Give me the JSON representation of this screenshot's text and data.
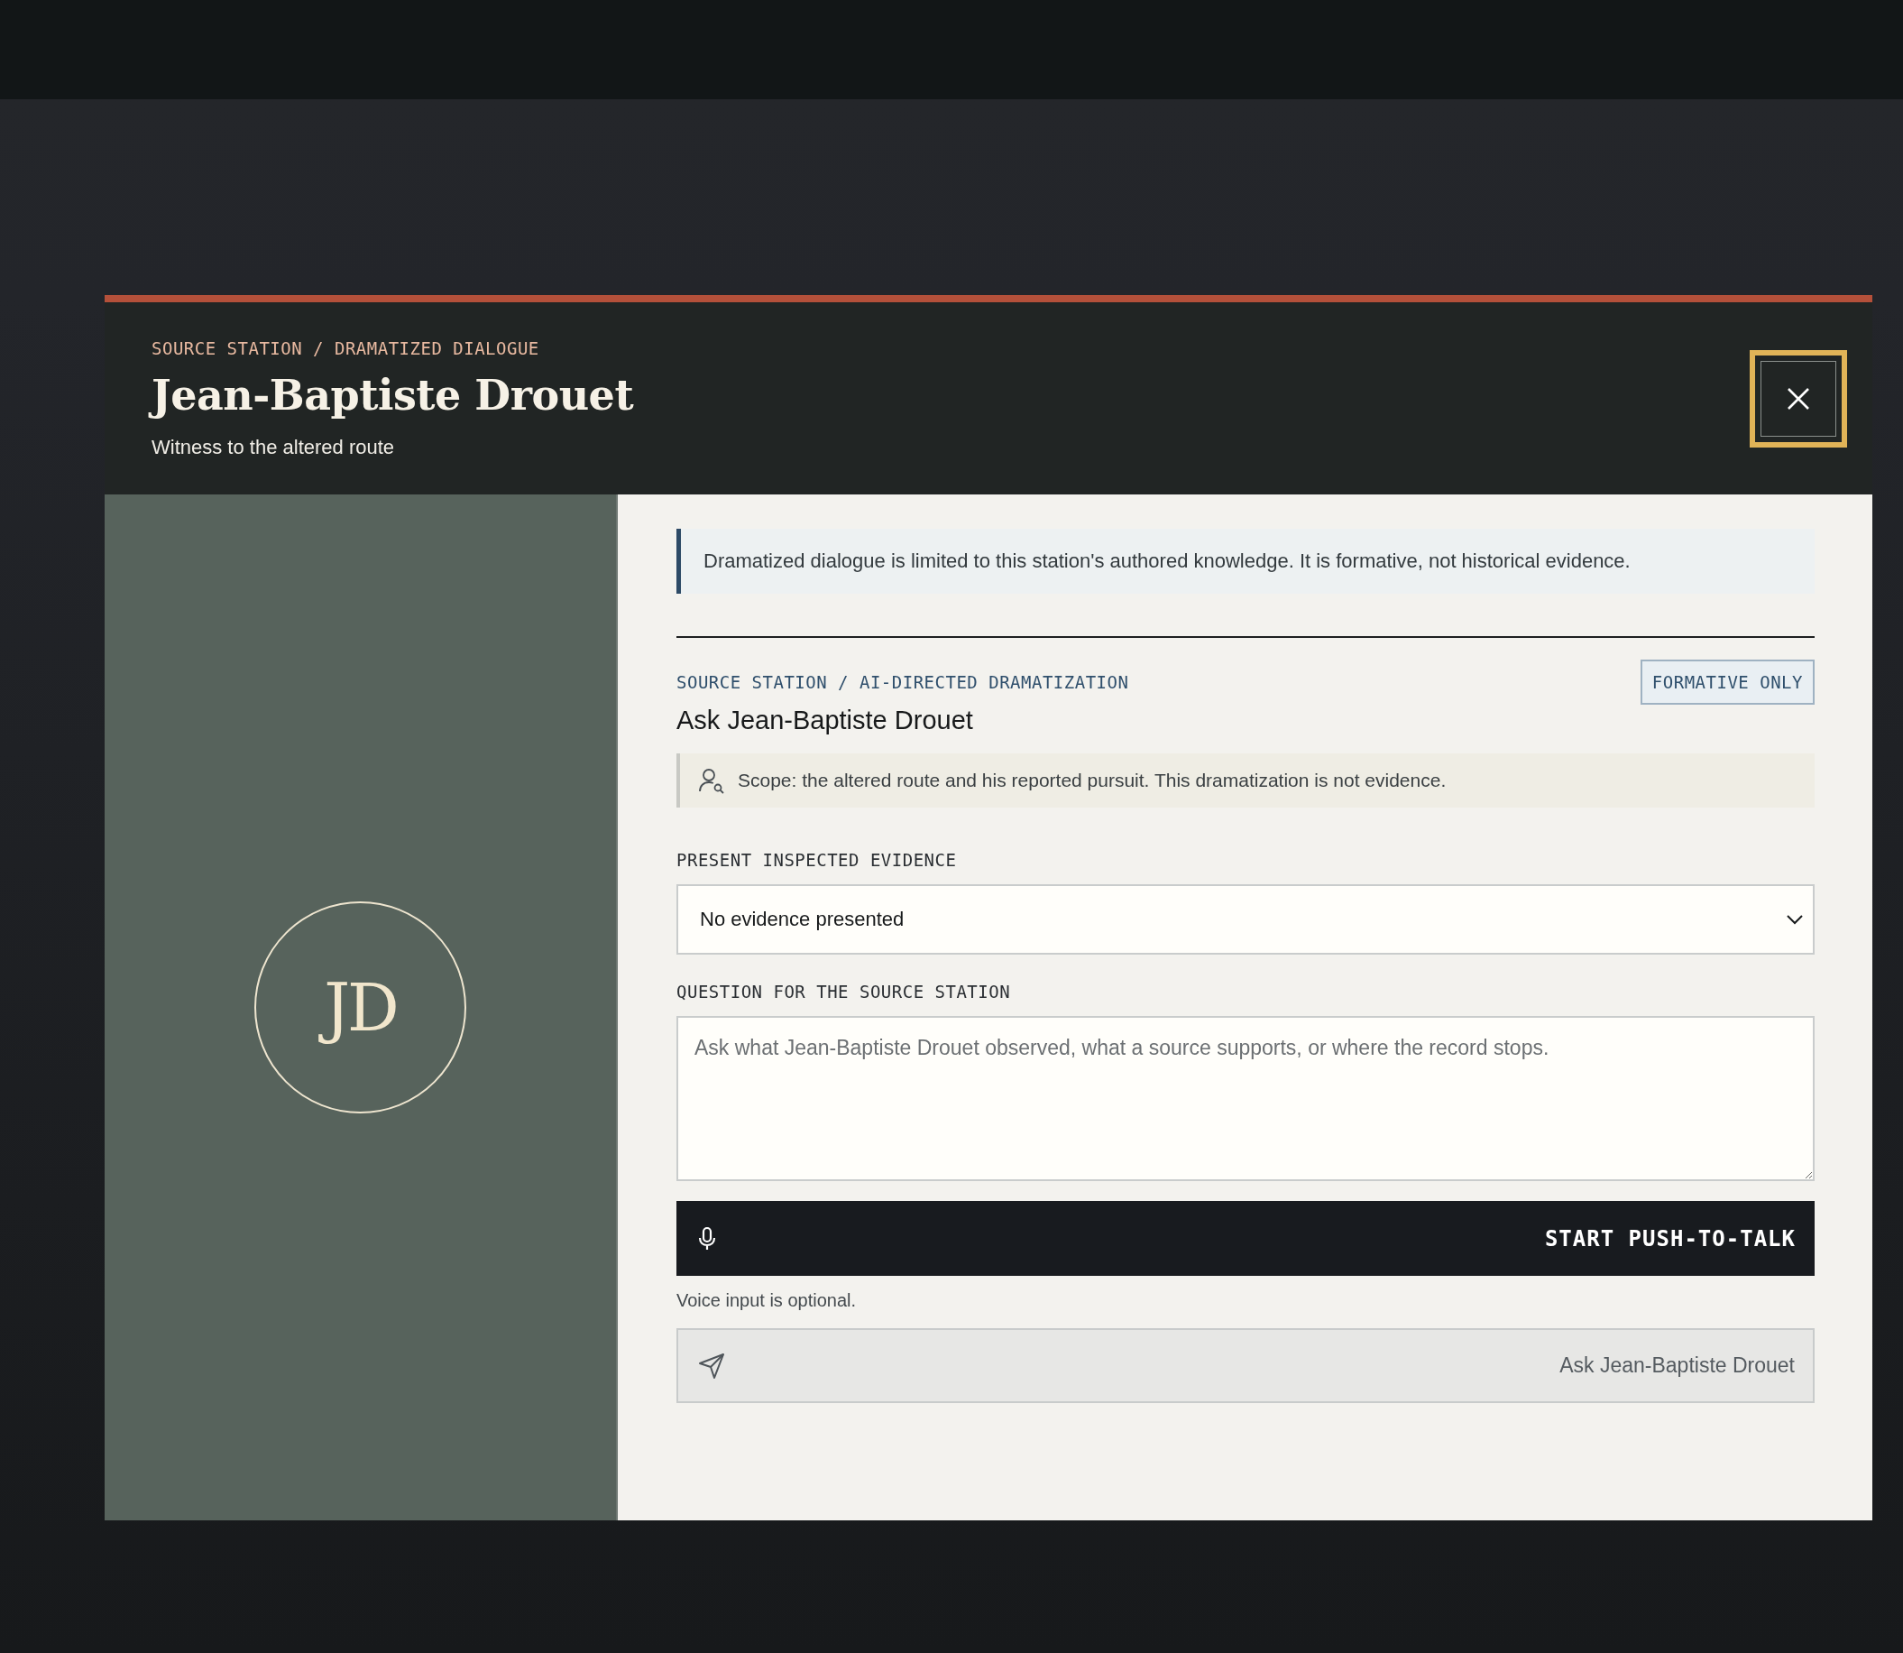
{
  "header": {
    "kicker": "SOURCE STATION / DRAMATIZED DIALOGUE",
    "title": "Jean-Baptiste Drouet",
    "subtitle": "Witness to the altered route"
  },
  "portrait": {
    "initials": "JD"
  },
  "notice": "Dramatized dialogue is limited to this station's authored knowledge. It is formative, not historical evidence.",
  "section": {
    "kicker": "SOURCE STATION / AI-DIRECTED DRAMATIZATION",
    "title": "Ask Jean-Baptiste Drouet",
    "badge": "FORMATIVE ONLY",
    "scope": "Scope: the altered route and his reported pursuit. This dramatization is not evidence."
  },
  "evidence": {
    "label": "PRESENT INSPECTED EVIDENCE",
    "value": "No evidence presented"
  },
  "question": {
    "label": "QUESTION FOR THE SOURCE STATION",
    "placeholder": "Ask what Jean-Baptiste Drouet observed, what a source supports, or where the record stops."
  },
  "push_to_talk": {
    "label": "START PUSH-TO-TALK"
  },
  "voice_note": "Voice input is optional.",
  "ask_button": {
    "label": "Ask Jean-Baptiste Drouet"
  }
}
